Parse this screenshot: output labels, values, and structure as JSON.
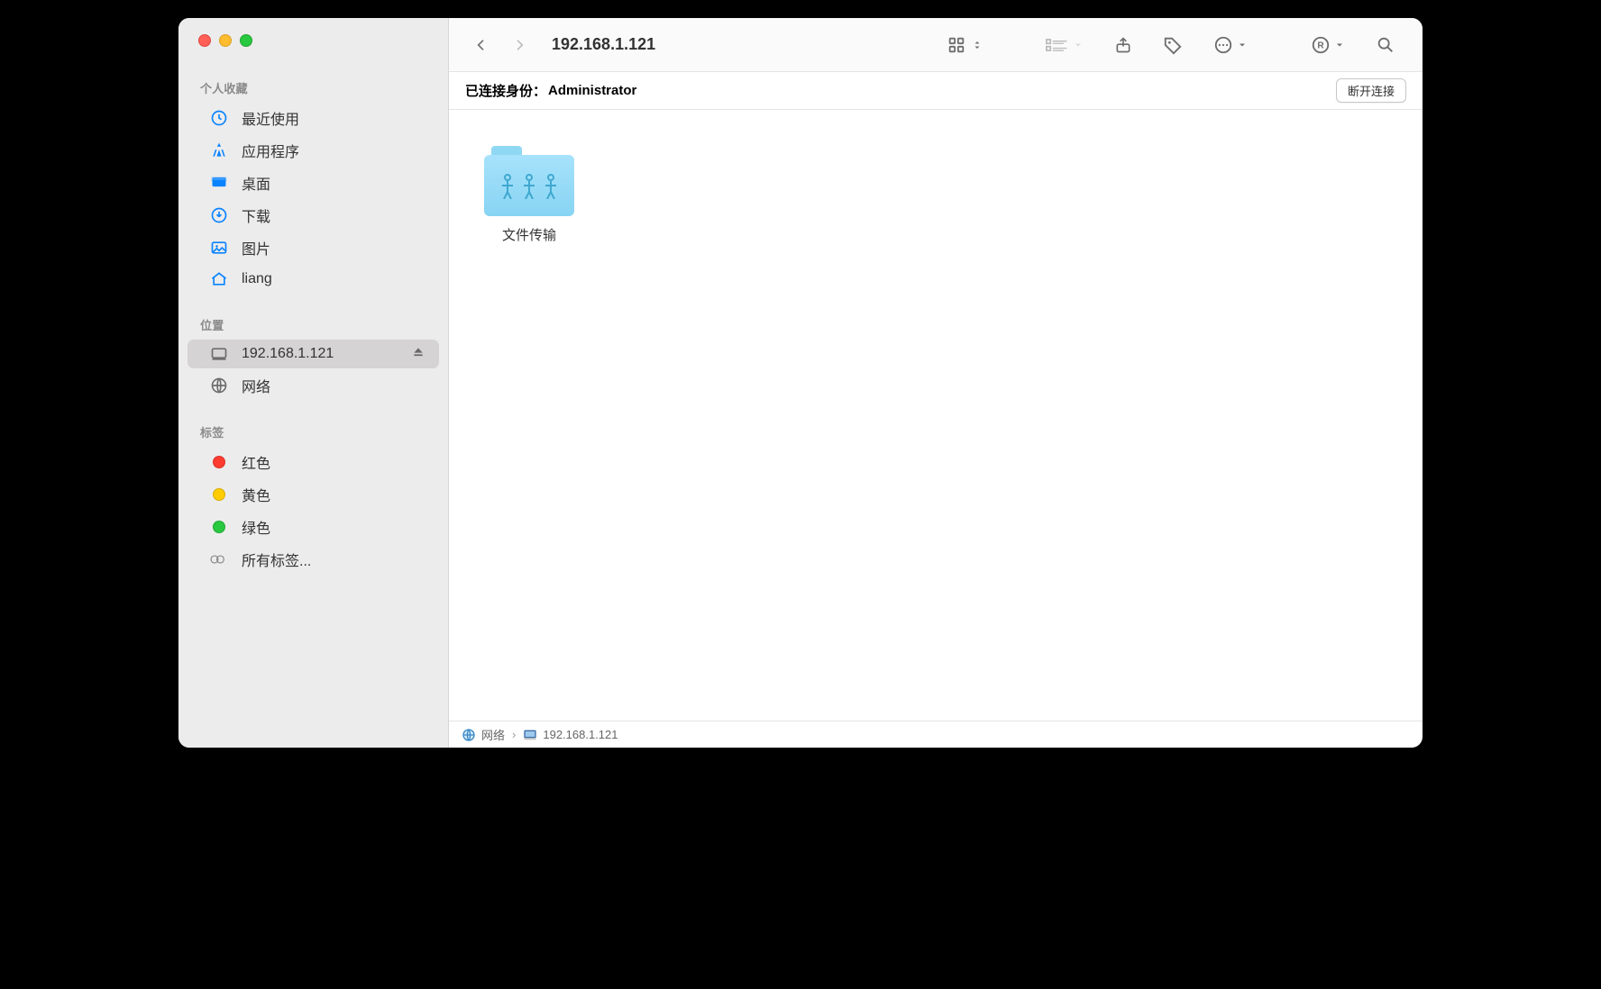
{
  "window": {
    "title": "192.168.1.121"
  },
  "sidebar": {
    "sections": {
      "favorites": {
        "title": "个人收藏",
        "items": [
          {
            "label": "最近使用",
            "icon": "clock"
          },
          {
            "label": "应用程序",
            "icon": "apps"
          },
          {
            "label": "桌面",
            "icon": "desktop"
          },
          {
            "label": "下载",
            "icon": "download"
          },
          {
            "label": "图片",
            "icon": "image"
          },
          {
            "label": "liang",
            "icon": "home"
          }
        ]
      },
      "locations": {
        "title": "位置",
        "items": [
          {
            "label": "192.168.1.121",
            "icon": "server",
            "ejectable": true,
            "selected": true
          },
          {
            "label": "网络",
            "icon": "globe"
          }
        ]
      },
      "tags": {
        "title": "标签",
        "items": [
          {
            "label": "红色",
            "color": "red"
          },
          {
            "label": "黄色",
            "color": "yellow"
          },
          {
            "label": "绿色",
            "color": "green"
          },
          {
            "label": "所有标签...",
            "all": true
          }
        ]
      }
    }
  },
  "connection": {
    "label": "已连接身份：",
    "user": "Administrator",
    "disconnect": "断开连接"
  },
  "content": {
    "items": [
      {
        "label": "文件传输",
        "type": "shared-folder"
      }
    ]
  },
  "pathbar": {
    "crumbs": [
      {
        "label": "网络",
        "icon": "globe"
      },
      {
        "label": "192.168.1.121",
        "icon": "server"
      }
    ]
  }
}
